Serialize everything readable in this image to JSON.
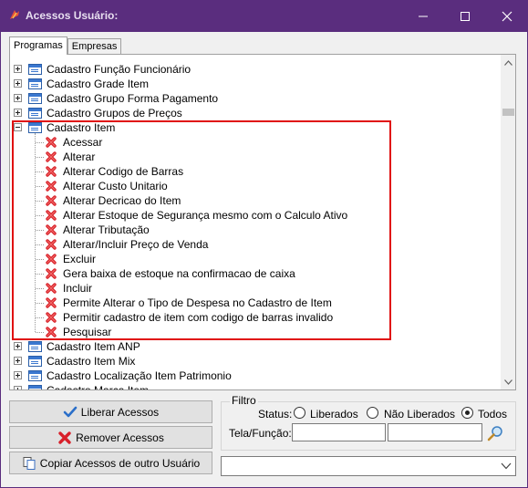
{
  "window": {
    "title": "Acessos Usuário:",
    "accent_color": "#5a2d7e",
    "buttons": [
      "minimize-icon",
      "maximize-icon",
      "close-icon"
    ]
  },
  "tabs": [
    {
      "label": "Programas",
      "active": true
    },
    {
      "label": "Empresas",
      "active": false
    }
  ],
  "tree": {
    "rows": [
      {
        "label": "Cadastro Função Funcionário",
        "kind": "parent",
        "expanded": false
      },
      {
        "label": "Cadastro Grade Item",
        "kind": "parent",
        "expanded": false
      },
      {
        "label": "Cadastro Grupo Forma Pagamento",
        "kind": "parent",
        "expanded": false
      },
      {
        "label": "Cadastro Grupos de Preços",
        "kind": "parent",
        "expanded": false
      },
      {
        "label": "Cadastro Item",
        "kind": "parent",
        "expanded": true
      },
      {
        "label": "Acessar",
        "kind": "child",
        "allowed": false
      },
      {
        "label": "Alterar",
        "kind": "child",
        "allowed": false
      },
      {
        "label": "Alterar Codigo de Barras",
        "kind": "child",
        "allowed": false
      },
      {
        "label": "Alterar Custo Unitario",
        "kind": "child",
        "allowed": false
      },
      {
        "label": "Alterar Decricao do Item",
        "kind": "child",
        "allowed": false
      },
      {
        "label": "Alterar Estoque de Segurança mesmo com o Calculo Ativo",
        "kind": "child",
        "allowed": false
      },
      {
        "label": "Alterar Tributação",
        "kind": "child",
        "allowed": false
      },
      {
        "label": "Alterar/Incluir Preço de Venda",
        "kind": "child",
        "allowed": false
      },
      {
        "label": "Excluir",
        "kind": "child",
        "allowed": false
      },
      {
        "label": "Gera baixa de estoque na confirmacao de caixa",
        "kind": "child",
        "allowed": false
      },
      {
        "label": "Incluir",
        "kind": "child",
        "allowed": false
      },
      {
        "label": "Permite Alterar o Tipo de Despesa no Cadastro de Item",
        "kind": "child",
        "allowed": false
      },
      {
        "label": "Permitir cadastro de item com codigo de barras invalido",
        "kind": "child",
        "allowed": false
      },
      {
        "label": "Pesquisar",
        "kind": "child",
        "allowed": false
      },
      {
        "label": "Cadastro Item ANP",
        "kind": "parent",
        "expanded": false
      },
      {
        "label": "Cadastro Item Mix",
        "kind": "parent",
        "expanded": false
      },
      {
        "label": "Cadastro Localização Item Patrimonio",
        "kind": "parent",
        "expanded": false
      },
      {
        "label": "Cadastro Marca Item",
        "kind": "parent",
        "expanded": false
      }
    ]
  },
  "actions": {
    "liberar": "Liberar Acessos",
    "remover": "Remover Acessos",
    "copiar": "Copiar Acessos de outro Usuário"
  },
  "filter": {
    "legend": "Filtro",
    "status_label": "Status:",
    "options": [
      {
        "label": "Liberados",
        "selected": false
      },
      {
        "label": "Não Liberados",
        "selected": false
      },
      {
        "label": "Todos",
        "selected": true
      }
    ],
    "tela_label": "Tela/Função:",
    "tela_code_value": "",
    "tela_name_value": ""
  },
  "user_combo": {
    "value": ""
  }
}
